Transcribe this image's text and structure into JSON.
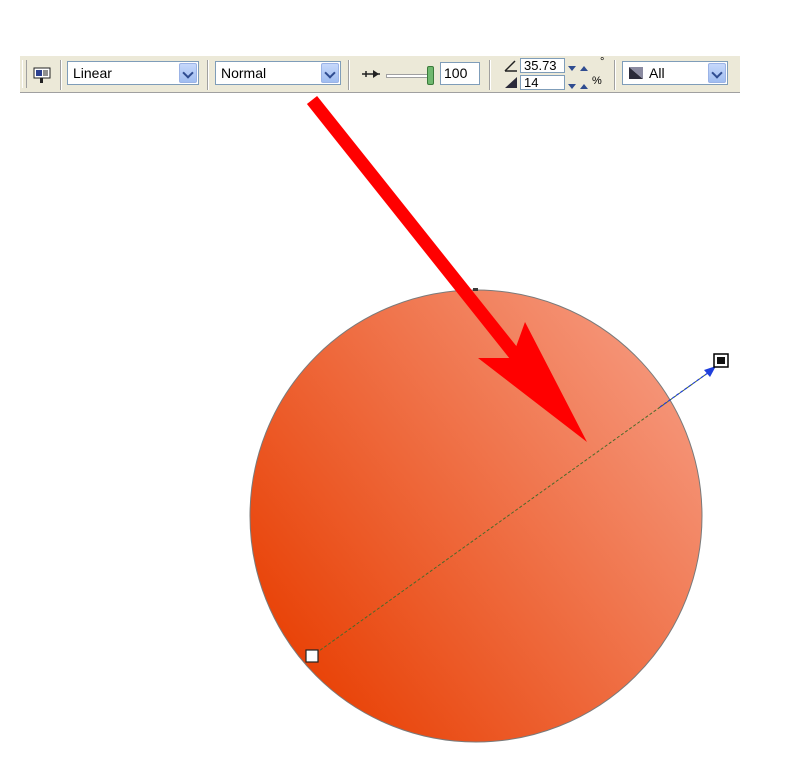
{
  "toolbar": {
    "fill_type": "Linear",
    "blend_mode": "Normal",
    "opacity": "100",
    "angle": "35.73",
    "edge_pad": "14",
    "degree_unit": "°",
    "percent_unit": "%",
    "apply_to": "All"
  },
  "colors": {
    "gradient_start": "#e84004",
    "gradient_end": "#f5967a",
    "arrow": "#ff0000",
    "vector_line": "#1f3fdc"
  }
}
